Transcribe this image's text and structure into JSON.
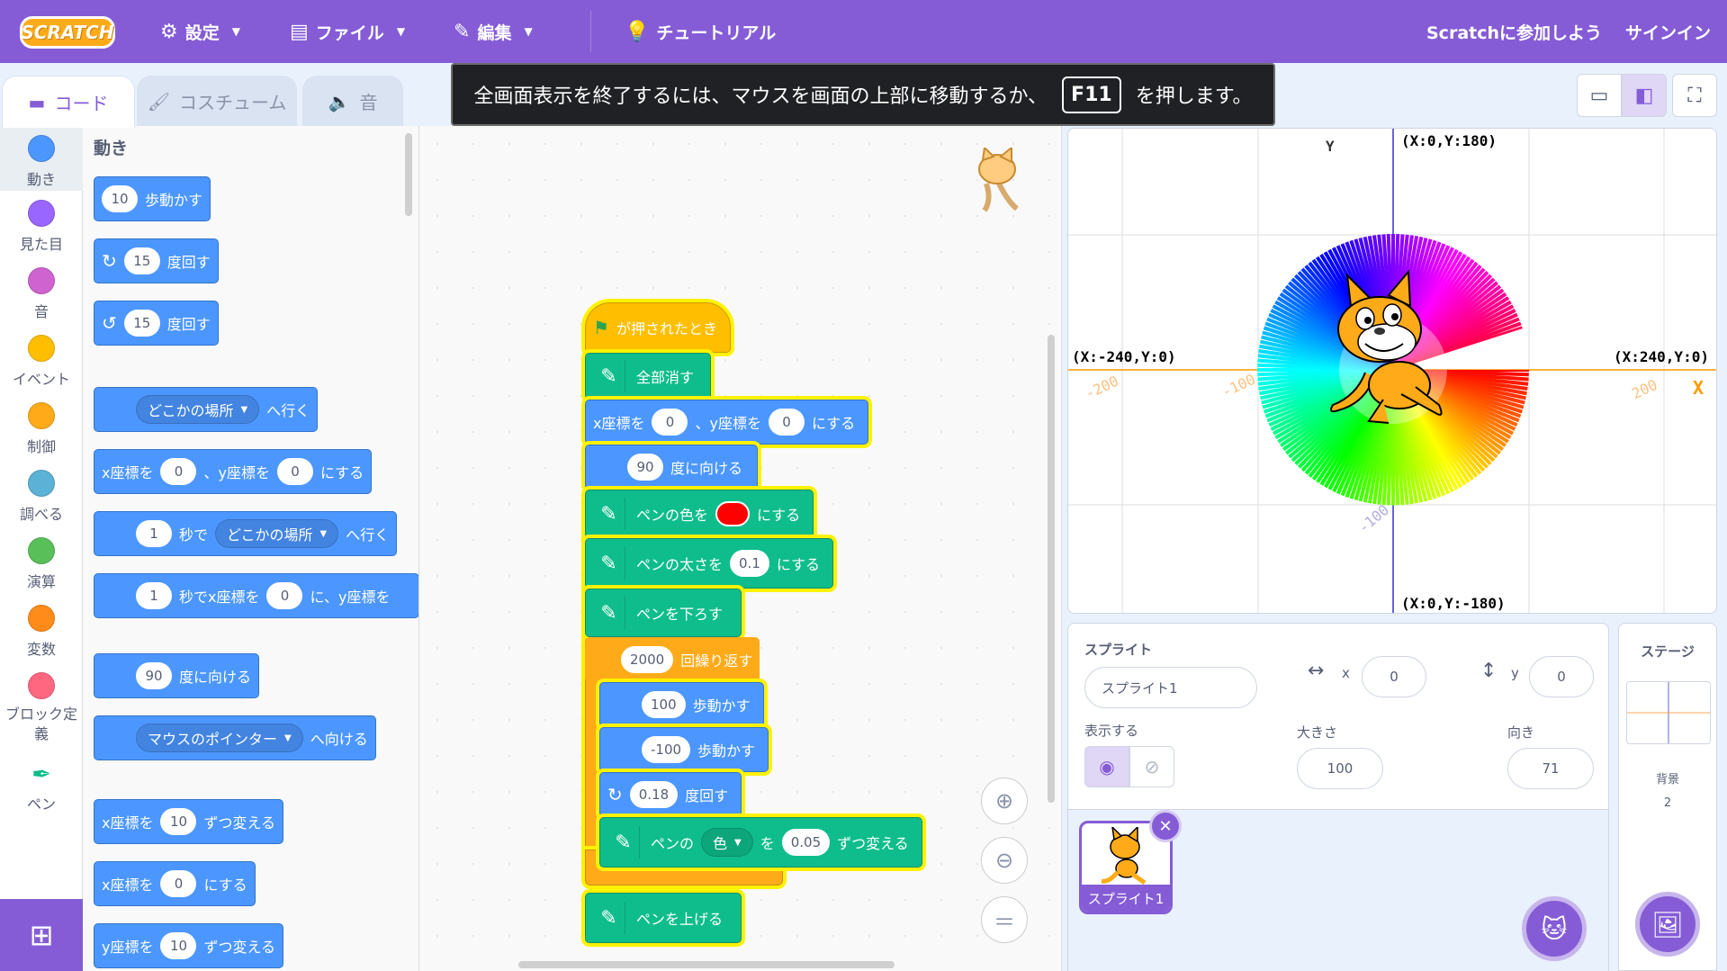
{
  "menubar": {
    "logo": "SCRATCH",
    "settings": "設定",
    "file": "ファイル",
    "edit": "編集",
    "tutorials": "チュートリアル",
    "join": "Scratchに参加しよう",
    "signin": "サインイン"
  },
  "toast": {
    "before": "全画面表示を終了するには、マウスを画面の上部に移動するか、",
    "key": "F11",
    "after": "を押します。"
  },
  "tabs": {
    "code": "コード",
    "costumes": "コスチューム",
    "sounds": "音"
  },
  "categories": [
    {
      "label": "動き",
      "color": "#4c97ff"
    },
    {
      "label": "見た目",
      "color": "#9966ff"
    },
    {
      "label": "音",
      "color": "#cf63cf"
    },
    {
      "label": "イベント",
      "color": "#ffbf00"
    },
    {
      "label": "制御",
      "color": "#ffab19"
    },
    {
      "label": "調べる",
      "color": "#5cb1d6"
    },
    {
      "label": "演算",
      "color": "#59c059"
    },
    {
      "label": "変数",
      "color": "#ff8c1a"
    },
    {
      "label": "ブロック定義",
      "color": "#ff6680"
    },
    {
      "label": "ペン",
      "color": "#0fbd8c"
    }
  ],
  "palette": {
    "heading": "動き",
    "b1": {
      "val": "10",
      "text": "歩動かす"
    },
    "b2": {
      "val": "15",
      "text": "度回す"
    },
    "b3": {
      "val": "15",
      "text": "度回す"
    },
    "b4": {
      "menu": "どこかの場所",
      "text": "へ行く"
    },
    "b5": {
      "t1": "x座標を",
      "v1": "0",
      "t2": "、y座標を",
      "v2": "0",
      "t3": "にする"
    },
    "b6": {
      "v1": "1",
      "t1": "秒で",
      "menu": "どこかの場所",
      "t2": "へ行く"
    },
    "b7": {
      "v1": "1",
      "t1": "秒でx座標を",
      "v2": "0",
      "t2": "に、y座標を"
    },
    "b8": {
      "val": "90",
      "text": "度に向ける"
    },
    "b9": {
      "menu": "マウスのポインター",
      "text": "へ向ける"
    },
    "b10": {
      "t1": "x座標を",
      "val": "10",
      "t2": "ずつ変える"
    },
    "b11": {
      "t1": "x座標を",
      "val": "0",
      "t2": "にする"
    },
    "b12": {
      "t1": "y座標を",
      "val": "10",
      "t2": "ずつ変える"
    }
  },
  "script": {
    "hat": "が押されたとき",
    "clear": "全部消す",
    "goto": {
      "t1": "x座標を",
      "v1": "0",
      "t2": "、y座標を",
      "v2": "0",
      "t3": "にする"
    },
    "point": {
      "val": "90",
      "text": "度に向ける"
    },
    "pencolor": {
      "t1": "ペンの色を",
      "t2": "にする",
      "color": "#ff0000"
    },
    "pensize": {
      "t1": "ペンの太さを",
      "val": "0.1",
      "t2": "にする"
    },
    "pendown": "ペンを下ろす",
    "repeat": {
      "val": "2000",
      "text": "回繰り返す"
    },
    "move1": {
      "val": "100",
      "text": "歩動かす"
    },
    "move2": {
      "val": "-100",
      "text": "歩動かす"
    },
    "turn": {
      "val": "0.18",
      "text": "度回す"
    },
    "change": {
      "t1": "ペンの",
      "menu": "色",
      "t2": "を",
      "val": "0.05",
      "t3": "ずつ変える"
    },
    "penup": "ペンを上げる"
  },
  "stage": {
    "y_axis": "Y",
    "x_axis": "X",
    "top": "(X:0,Y:180)",
    "bottom": "(X:0,Y:-180)",
    "left": "(X:-240,Y:0)",
    "right": "(X:240,Y:0)",
    "tick_l200": "-200",
    "tick_l100": "-100",
    "tick_r200": "200",
    "tick_b100": "-100"
  },
  "sprite": {
    "label": "スプライト",
    "name": "スプライト1",
    "x": "0",
    "y": "0",
    "x_label": "x",
    "y_label": "y",
    "show_label": "表示する",
    "size_label": "大きさ",
    "size": "100",
    "direction_label": "向き",
    "direction": "71",
    "thumb_caption": "スプライト1"
  },
  "stagepane": {
    "title": "ステージ",
    "backdrop_label": "背景",
    "backdrop_count": "2"
  },
  "colors": {
    "accent": "#855cd6",
    "motion": "#4c97ff",
    "pen": "#0fbd8c",
    "event": "#ffbf00",
    "control": "#ffab19",
    "highlight": "#fff200"
  }
}
